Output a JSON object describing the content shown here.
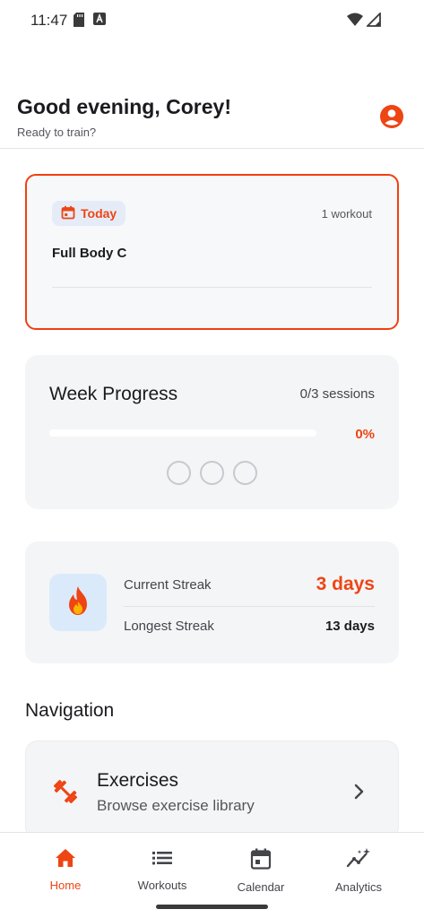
{
  "status_bar": {
    "time": "11:47",
    "icons": [
      "sd-card-icon",
      "a-badge-icon",
      "wifi-icon",
      "signal-icon"
    ]
  },
  "header": {
    "greeting": "Good evening, Corey!",
    "subtitle": "Ready to train?",
    "profile_icon": "account-circle-icon"
  },
  "today_card": {
    "chip_label": "Today",
    "chip_icon": "calendar-icon",
    "count": "1 workout",
    "workout_name": "Full Body C"
  },
  "week_progress": {
    "title": "Week Progress",
    "sessions": "0/3 sessions",
    "percent_label": "0%",
    "progress_fraction": 0,
    "session_dots": [
      false,
      false,
      false
    ]
  },
  "streak": {
    "icon": "flame-icon",
    "current_label": "Current Streak",
    "current_value": "3 days",
    "longest_label": "Longest Streak",
    "longest_value": "13 days"
  },
  "navigation": {
    "heading": "Navigation",
    "items": [
      {
        "icon": "dumbbell-icon",
        "title": "Exercises",
        "subtitle": "Browse exercise library"
      }
    ]
  },
  "bottom_nav": {
    "items": [
      {
        "label": "Home",
        "icon": "home-icon",
        "active": true
      },
      {
        "label": "Workouts",
        "icon": "list-icon",
        "active": false
      },
      {
        "label": "Calendar",
        "icon": "calendar-icon",
        "active": false
      },
      {
        "label": "Analytics",
        "icon": "analytics-icon",
        "active": false
      }
    ]
  },
  "colors": {
    "accent": "#ee4514",
    "card_bg": "#f4f5f7",
    "chip_bg": "#e5ecf7",
    "flame_bg": "#dbeafb",
    "text": "#1b1b1f"
  }
}
